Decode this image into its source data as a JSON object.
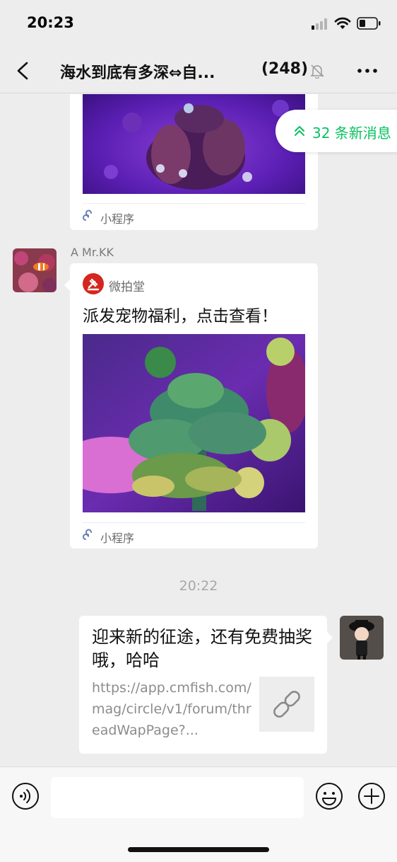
{
  "status_bar": {
    "time": "20:23"
  },
  "nav": {
    "back_icon": "chevron-left-icon",
    "title": "海水到底有多深⇔自...",
    "member_count": "(248)",
    "mute_icon": "bell-off-icon",
    "more_icon": "more-dots-icon"
  },
  "new_messages": {
    "label": "32 条新消息",
    "icon": "double-chevron-up-icon",
    "color": "#07c160"
  },
  "messages": [
    {
      "type": "mini_program",
      "footer_label": "小程序",
      "footer_icon": "mini-program-icon"
    },
    {
      "type": "mini_program",
      "sender": "A  Mr.KK",
      "brand": "微拍堂",
      "brand_icon": "weipaitang-logo-icon",
      "title": "派发宠物福利，点击查看！",
      "footer_label": "小程序",
      "footer_icon": "mini-program-icon"
    },
    {
      "type": "timestamp",
      "text": "20:22"
    },
    {
      "type": "link",
      "title": "迎来新的征途，还有免费抽奖哦，哈哈",
      "url": "https://app.cmfish.com/mag/circle/v1/forum/threadWapPage?...",
      "thumb_icon": "link-icon"
    }
  ],
  "input_bar": {
    "voice_icon": "voice-icon",
    "input_value": "",
    "emoji_icon": "emoji-icon",
    "plus_icon": "plus-circle-icon"
  }
}
